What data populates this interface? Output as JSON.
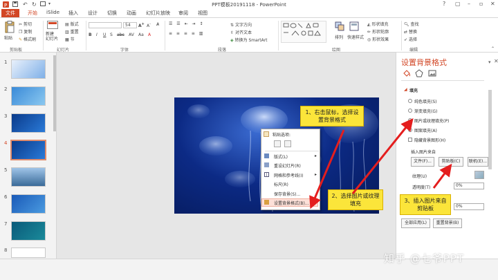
{
  "window": {
    "title": "PPT模板20191118 - PowerPoint",
    "controls": [
      "?",
      "▢",
      "–",
      "▫",
      "✕"
    ]
  },
  "tabs": [
    "文件",
    "开始",
    "iSlide",
    "插入",
    "设计",
    "切换",
    "动画",
    "幻灯片放映",
    "审阅",
    "视图"
  ],
  "ribbon": {
    "clipboard": {
      "paste": "粘贴",
      "cut": "剪切",
      "copy": "复制",
      "format_painter": "格式刷",
      "label": "剪贴板"
    },
    "slides": {
      "new_slide": "新建\n幻灯片",
      "layout": "版式",
      "reset": "重置",
      "section": "节",
      "label": "幻灯片"
    },
    "font": {
      "font_name": "",
      "font_size": "54",
      "label": "字体"
    },
    "paragraph": {
      "text_direction": "文字方向",
      "align_text": "对齐文本",
      "smartart": "转换为 SmartArt",
      "label": "段落"
    },
    "drawing": {
      "arrange": "排列",
      "quick_styles": "快速样式",
      "shape_fill": "形状填充",
      "shape_outline": "形状轮廓",
      "shape_effects": "形状效果",
      "label": "绘图"
    },
    "editing": {
      "find": "查找",
      "replace": "替换",
      "select": "选择",
      "label": "编辑"
    }
  },
  "thumbnails": [
    "1",
    "2",
    "3",
    "4",
    "5",
    "6",
    "7",
    "8"
  ],
  "context_menu": {
    "paste_options": "粘贴选项:",
    "items": [
      "版式(L)",
      "重设幻灯片(R)",
      "网格和参考线(I)",
      "标尺(R)",
      "保存背景(S)...",
      "设置背景格式(B)..."
    ]
  },
  "pane": {
    "title": "设置背景格式",
    "section_fill": "填充",
    "options": [
      "纯色填充(S)",
      "渐变填充(G)",
      "图片或纹理填充(P)",
      "图案填充(A)"
    ],
    "hide_bg": "隐藏背景图形(H)",
    "insert_from": "插入图片来自",
    "btn_file": "文件(F)...",
    "btn_clipboard": "剪贴板(C)",
    "btn_online": "联机(E)...",
    "texture_label": "纹理(U)",
    "transparency_label": "透明度(T)",
    "transparency_value": "0%",
    "offset_value": "0%",
    "btn_apply_all": "全部应用(L)",
    "btn_reset": "重置背景(B)"
  },
  "annotations": {
    "note1": "1、右击鼠标，选择设置背景格式",
    "note2": "2、选择图片或纹理填充",
    "note3": "3、插入图片来自剪贴板"
  },
  "watermark": "知乎 @七爷PPT",
  "colors": {
    "accent": "#d24726",
    "note": "#fbe53a",
    "arrow": "#e41e1e"
  }
}
